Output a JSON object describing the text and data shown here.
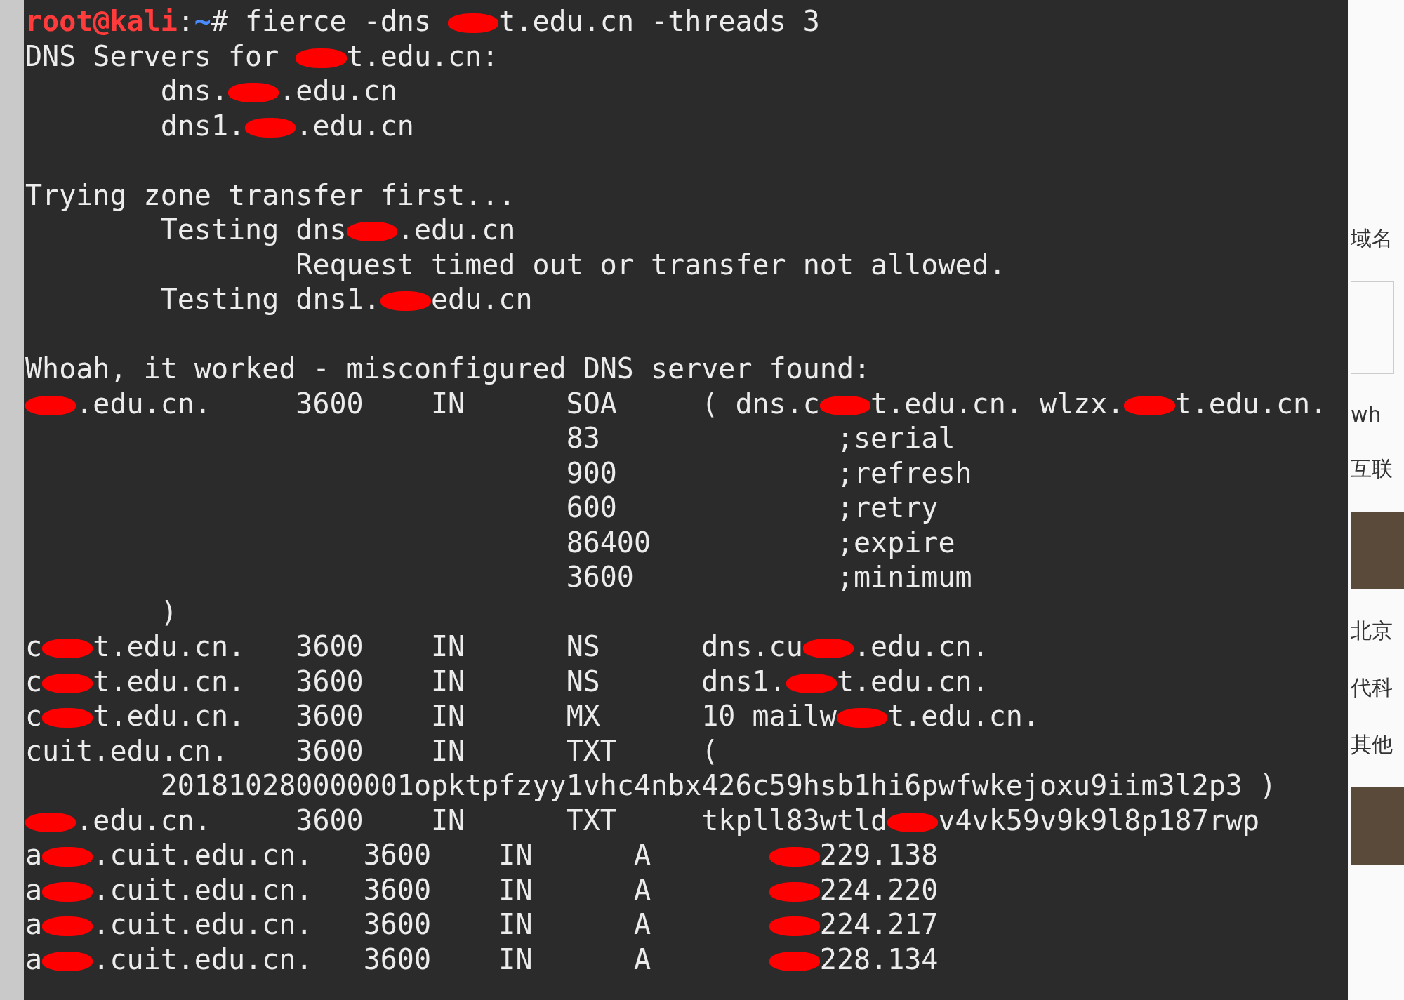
{
  "terminal": {
    "lines": [
      {
        "kind": "output",
        "segments": [
          {
            "kind": "user",
            "text": "root@kali"
          },
          {
            "kind": "text",
            "text": ":"
          },
          {
            "kind": "path",
            "text": "~"
          },
          {
            "kind": "text",
            "text": "# fierce -dns "
          },
          {
            "kind": "redaction"
          },
          {
            "kind": "text",
            "text": "t.edu.cn -threads 3"
          }
        ]
      },
      {
        "kind": "output",
        "segments": [
          {
            "kind": "text",
            "text": "DNS Servers for "
          },
          {
            "kind": "redaction"
          },
          {
            "kind": "text",
            "text": "t.edu.cn:"
          }
        ]
      },
      {
        "kind": "output",
        "segments": [
          {
            "kind": "text",
            "text": "        dns."
          },
          {
            "kind": "redaction"
          },
          {
            "kind": "text",
            "text": ".edu.cn"
          }
        ]
      },
      {
        "kind": "output",
        "segments": [
          {
            "kind": "text",
            "text": "        dns1."
          },
          {
            "kind": "redaction"
          },
          {
            "kind": "text",
            "text": ".edu.cn"
          }
        ]
      },
      {
        "kind": "blank"
      },
      {
        "kind": "output",
        "segments": [
          {
            "kind": "text",
            "text": "Trying zone transfer first..."
          }
        ]
      },
      {
        "kind": "output",
        "segments": [
          {
            "kind": "text",
            "text": "        Testing dns"
          },
          {
            "kind": "redaction"
          },
          {
            "kind": "text",
            "text": ".edu.cn"
          }
        ]
      },
      {
        "kind": "output",
        "segments": [
          {
            "kind": "text",
            "text": "                Request timed out or transfer not allowed."
          }
        ]
      },
      {
        "kind": "output",
        "segments": [
          {
            "kind": "text",
            "text": "        Testing dns1."
          },
          {
            "kind": "redaction"
          },
          {
            "kind": "text",
            "text": "edu.cn"
          }
        ]
      },
      {
        "kind": "blank"
      },
      {
        "kind": "output",
        "segments": [
          {
            "kind": "text",
            "text": "Whoah, it worked - misconfigured DNS server found:"
          }
        ]
      },
      {
        "kind": "output",
        "segments": [
          {
            "kind": "redaction"
          },
          {
            "kind": "text",
            "text": ".edu.cn.     3600    IN      SOA     ( dns.c"
          },
          {
            "kind": "redaction"
          },
          {
            "kind": "text",
            "text": "t.edu.cn. wlzx."
          },
          {
            "kind": "redaction"
          },
          {
            "kind": "text",
            "text": "t.edu.cn."
          }
        ]
      },
      {
        "kind": "output",
        "segments": [
          {
            "kind": "text",
            "text": "                                83              ;serial"
          }
        ]
      },
      {
        "kind": "output",
        "segments": [
          {
            "kind": "text",
            "text": "                                900             ;refresh"
          }
        ]
      },
      {
        "kind": "output",
        "segments": [
          {
            "kind": "text",
            "text": "                                600             ;retry"
          }
        ]
      },
      {
        "kind": "output",
        "segments": [
          {
            "kind": "text",
            "text": "                                86400           ;expire"
          }
        ]
      },
      {
        "kind": "output",
        "segments": [
          {
            "kind": "text",
            "text": "                                3600            ;minimum"
          }
        ]
      },
      {
        "kind": "output",
        "segments": [
          {
            "kind": "text",
            "text": "        )"
          }
        ]
      },
      {
        "kind": "output",
        "segments": [
          {
            "kind": "text",
            "text": "c"
          },
          {
            "kind": "redaction"
          },
          {
            "kind": "text",
            "text": "t.edu.cn.   3600    IN      NS      dns.cu"
          },
          {
            "kind": "redaction"
          },
          {
            "kind": "text",
            "text": ".edu.cn."
          }
        ]
      },
      {
        "kind": "output",
        "segments": [
          {
            "kind": "text",
            "text": "c"
          },
          {
            "kind": "redaction"
          },
          {
            "kind": "text",
            "text": "t.edu.cn.   3600    IN      NS      dns1."
          },
          {
            "kind": "redaction"
          },
          {
            "kind": "text",
            "text": "t.edu.cn."
          }
        ]
      },
      {
        "kind": "output",
        "segments": [
          {
            "kind": "text",
            "text": "c"
          },
          {
            "kind": "redaction"
          },
          {
            "kind": "text",
            "text": "t.edu.cn.   3600    IN      MX      10 mailw"
          },
          {
            "kind": "redaction"
          },
          {
            "kind": "text",
            "text": "t.edu.cn."
          }
        ]
      },
      {
        "kind": "output",
        "segments": [
          {
            "kind": "text",
            "text": "cuit.edu.cn.    3600    IN      TXT     ("
          }
        ]
      },
      {
        "kind": "output",
        "segments": [
          {
            "kind": "text",
            "text": "        201810280000001opktpfzyy1vhc4nbx426c59hsb1hi6pwfwkejoxu9iim3l2p3 )"
          }
        ]
      },
      {
        "kind": "output",
        "segments": [
          {
            "kind": "redaction"
          },
          {
            "kind": "text",
            "text": ".edu.cn.     3600    IN      TXT     tkpll83wtld"
          },
          {
            "kind": "redaction"
          },
          {
            "kind": "text",
            "text": "v4vk59v9k9l8p187rwp"
          }
        ]
      },
      {
        "kind": "output",
        "segments": [
          {
            "kind": "text",
            "text": "a"
          },
          {
            "kind": "redaction"
          },
          {
            "kind": "text",
            "text": ".cuit.edu.cn.   3600    IN      A       "
          },
          {
            "kind": "redaction"
          },
          {
            "kind": "text",
            "text": "229.138"
          }
        ]
      },
      {
        "kind": "output",
        "segments": [
          {
            "kind": "text",
            "text": "a"
          },
          {
            "kind": "redaction"
          },
          {
            "kind": "text",
            "text": ".cuit.edu.cn.   3600    IN      A       "
          },
          {
            "kind": "redaction"
          },
          {
            "kind": "text",
            "text": "224.220"
          }
        ]
      },
      {
        "kind": "output",
        "segments": [
          {
            "kind": "text",
            "text": "a"
          },
          {
            "kind": "redaction"
          },
          {
            "kind": "text",
            "text": ".cuit.edu.cn.   3600    IN      A       "
          },
          {
            "kind": "redaction"
          },
          {
            "kind": "text",
            "text": "224.217"
          }
        ]
      },
      {
        "kind": "output",
        "segments": [
          {
            "kind": "text",
            "text": "a"
          },
          {
            "kind": "redaction"
          },
          {
            "kind": "text",
            "text": ".cuit.edu.cn.   3600    IN      A       "
          },
          {
            "kind": "redaction"
          },
          {
            "kind": "text",
            "text": "228.134"
          }
        ]
      }
    ]
  },
  "browser_sidebar": {
    "items": [
      {
        "kind": "text",
        "text": "域名"
      },
      {
        "kind": "thumbnail"
      },
      {
        "kind": "text",
        "text": "wh"
      },
      {
        "kind": "text",
        "text": "互联"
      },
      {
        "kind": "photo"
      },
      {
        "kind": "text",
        "text": "北京"
      },
      {
        "kind": "text",
        "text": "代科"
      },
      {
        "kind": "text",
        "text": "其他"
      },
      {
        "kind": "photo"
      }
    ]
  }
}
